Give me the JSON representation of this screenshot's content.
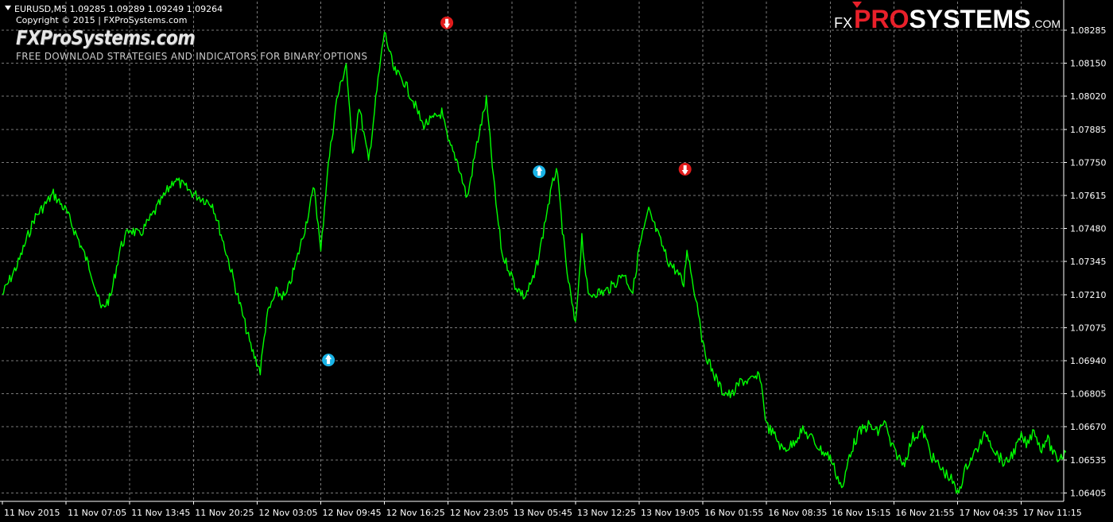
{
  "header": {
    "symbol_info": "EURUSD,M5  1.09285 1.09289 1.09249 1.09264",
    "copyright": "Copyright © 2015 | FXProSystems.com",
    "site_title": "FXProSystems.com",
    "tagline": "FREE DOWNLOAD STRATEGIES AND INDICATORS FOR BINARY OPTIONS"
  },
  "brand": {
    "prefix": "FX",
    "highlight": "PRO",
    "main": "SYSTEMS",
    "suffix": ".COM"
  },
  "colors": {
    "background": "#000000",
    "grid": "#7a7a7a",
    "price_line": "#00ff00",
    "sell_arrow": "#e01b1b",
    "buy_arrow": "#19b3e6",
    "text": "#ffffff"
  },
  "chart_data": {
    "type": "line",
    "symbol": "EURUSD",
    "timeframe": "M5",
    "grid": true,
    "ylim": [
      1.0634,
      1.0836
    ],
    "y_ticks": [
      "1.08285",
      "1.08150",
      "1.08020",
      "1.07885",
      "1.07750",
      "1.07615",
      "1.07480",
      "1.07345",
      "1.07210",
      "1.07075",
      "1.06940",
      "1.06805",
      "1.06670",
      "1.06535",
      "1.06405"
    ],
    "x_ticks": [
      "11 Nov 2015",
      "11 Nov 07:05",
      "11 Nov 13:45",
      "11 Nov 20:25",
      "12 Nov 03:05",
      "12 Nov 09:45",
      "12 Nov 16:25",
      "12 Nov 23:05",
      "13 Nov 05:45",
      "13 Nov 12:25",
      "13 Nov 19:05",
      "16 Nov 01:55",
      "16 Nov 08:35",
      "16 Nov 15:15",
      "16 Nov 21:55",
      "17 Nov 04:35",
      "17 Nov 11:15"
    ],
    "series": [
      {
        "x_index": [
          0,
          0.25,
          0.5,
          0.8,
          1.0,
          1.2,
          1.4,
          1.55,
          1.7,
          1.85,
          2.0,
          2.15,
          2.4,
          2.7,
          3.0,
          3.3,
          3.55,
          3.7,
          3.9,
          4.05,
          4.15,
          4.3,
          4.45,
          4.6,
          4.75,
          4.9,
          5.0,
          5.1,
          5.25,
          5.4,
          5.5,
          5.6,
          5.75,
          5.9,
          6.0,
          6.15,
          6.3,
          6.45,
          6.6,
          6.75,
          6.9,
          7.0,
          7.15,
          7.3,
          7.45,
          7.6,
          7.75,
          7.85,
          7.95,
          8.05,
          8.2,
          8.35,
          8.45,
          8.55,
          8.7,
          8.85,
          9.0,
          9.1,
          9.2,
          9.3,
          9.45,
          9.6,
          9.75,
          9.9,
          10.0,
          10.15,
          10.3,
          10.45,
          10.6,
          10.7,
          10.75,
          10.85,
          10.95,
          11.0,
          11.15,
          11.3,
          11.45,
          11.6,
          11.75,
          11.9,
          12.0,
          12.15,
          12.25,
          12.4,
          12.55,
          12.7,
          12.85,
          13.0,
          13.1,
          13.2,
          13.3,
          13.45,
          13.6,
          13.75,
          13.85,
          13.95,
          14.05,
          14.15,
          14.3,
          14.45,
          14.6,
          14.75,
          14.9,
          15.0,
          15.15,
          15.3,
          15.45,
          15.6,
          15.75,
          15.9,
          16.0,
          16.1,
          16.2,
          16.3,
          16.4,
          16.55,
          16.7
        ],
        "values": [
          1.0721,
          1.0734,
          1.0752,
          1.0762,
          1.0755,
          1.0743,
          1.073,
          1.0715,
          1.072,
          1.074,
          1.0748,
          1.0745,
          1.0755,
          1.0768,
          1.0762,
          1.0758,
          1.0735,
          1.072,
          1.07,
          1.069,
          1.0712,
          1.0722,
          1.072,
          1.0733,
          1.0748,
          1.0765,
          1.0738,
          1.077,
          1.08,
          1.0815,
          1.0778,
          1.0798,
          1.0775,
          1.0808,
          1.0828,
          1.0812,
          1.0808,
          1.08,
          1.079,
          1.0792,
          1.0795,
          1.0783,
          1.0775,
          1.076,
          1.0782,
          1.08,
          1.0758,
          1.0737,
          1.0732,
          1.0725,
          1.072,
          1.0728,
          1.074,
          1.0755,
          1.0773,
          1.0733,
          1.0708,
          1.0745,
          1.072,
          1.0722,
          1.0722,
          1.0725,
          1.073,
          1.0722,
          1.074,
          1.0755,
          1.0745,
          1.0735,
          1.073,
          1.0725,
          1.074,
          1.0725,
          1.0712,
          1.07,
          1.069,
          1.0682,
          1.068,
          1.0686,
          1.0686,
          1.0688,
          1.0668,
          1.0663,
          1.0658,
          1.066,
          1.0666,
          1.0663,
          1.0658,
          1.0655,
          1.0648,
          1.0642,
          1.0656,
          1.0665,
          1.0668,
          1.0665,
          1.067,
          1.066,
          1.0656,
          1.0652,
          1.0663,
          1.0666,
          1.0655,
          1.065,
          1.0646,
          1.064,
          1.0652,
          1.0658,
          1.0665,
          1.0657,
          1.0652,
          1.0658,
          1.0663,
          1.066,
          1.0667,
          1.0658,
          1.0663,
          1.0654,
          1.0657
        ]
      }
    ],
    "signals": [
      {
        "type": "buy",
        "x_index": 5.12,
        "price": 1.06945
      },
      {
        "type": "sell",
        "x_index": 6.98,
        "price": 1.08315
      },
      {
        "type": "buy",
        "x_index": 8.43,
        "price": 1.0771
      },
      {
        "type": "sell",
        "x_index": 10.72,
        "price": 1.0772
      }
    ]
  }
}
